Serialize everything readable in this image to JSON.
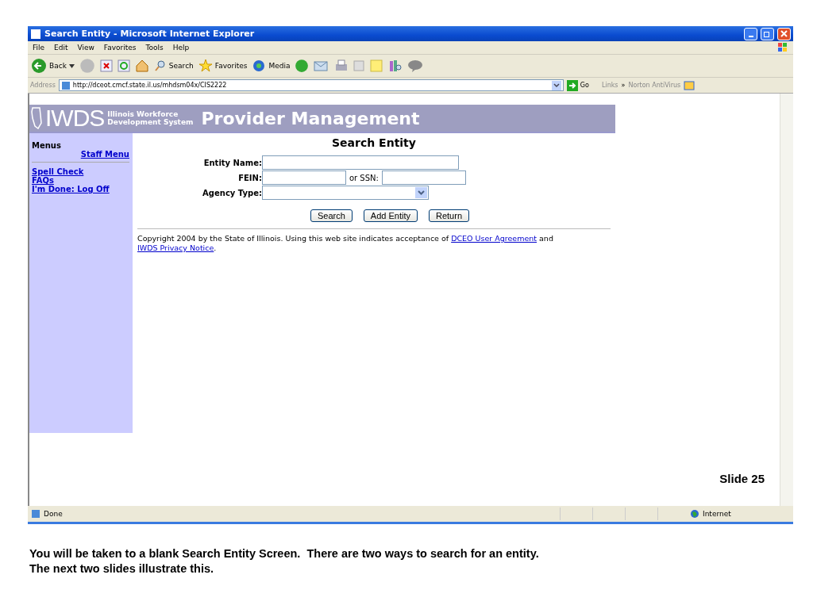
{
  "window": {
    "title": "Search Entity - Microsoft Internet Explorer"
  },
  "menu_bar": [
    "File",
    "Edit",
    "View",
    "Favorites",
    "Tools",
    "Help"
  ],
  "toolbar": {
    "back": "Back",
    "search": "Search",
    "favorites": "Favorites",
    "media": "Media"
  },
  "address_bar": {
    "label": "Address",
    "url": "http://dceot.cmcf.state.il.us/mhdsm04x/CIS2222",
    "go": "Go",
    "links": "Links",
    "links_more": "»",
    "norton": "Norton AntiVirus"
  },
  "banner": {
    "logo": "IWDS",
    "subtitle_1": "Illinois Workforce",
    "subtitle_2": "Development System",
    "title": "Provider Management"
  },
  "sidebar": {
    "heading": "Menus",
    "staff_menu": "Staff Menu",
    "links": [
      "Spell Check",
      "FAQs",
      "I'm Done: Log Off"
    ]
  },
  "form": {
    "title": "Search Entity",
    "entity_name": {
      "label": "Entity Name:"
    },
    "fein": {
      "label": "FEIN:"
    },
    "ssn": {
      "label": "or SSN:"
    },
    "agency_type": {
      "label": "Agency Type:"
    },
    "buttons": [
      "Search",
      "Add Entity",
      "Return"
    ]
  },
  "copyright": [
    {
      "kind": "text",
      "text": "Copyright 2004 by the State of Illinois. Using this web site indicates acceptance of "
    },
    {
      "kind": "link",
      "text": "DCEO User Agreement"
    },
    {
      "kind": "text",
      "text": " and "
    },
    {
      "kind": "link",
      "text": "IWDS Privacy Notice"
    },
    {
      "kind": "text",
      "text": "."
    }
  ],
  "slide_label": "Slide 25",
  "status_bar": {
    "status": "Done",
    "zone": "Internet"
  },
  "caption": [
    "You will be taken to a blank Search Entity Screen.  There are two ways to search for an entity.",
    "The next two slides illustrate this."
  ]
}
